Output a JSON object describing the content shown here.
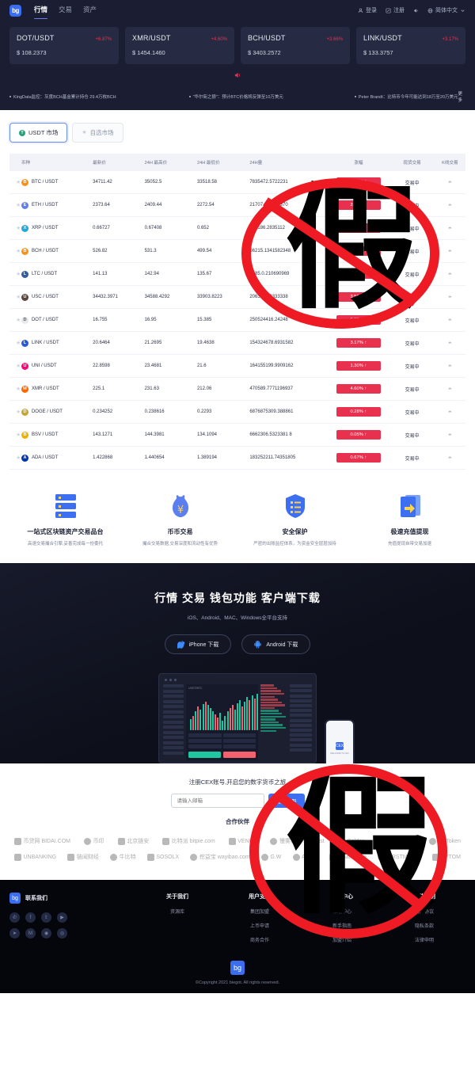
{
  "header": {
    "logo": "bg",
    "nav": [
      {
        "label": "行情",
        "active": true
      },
      {
        "label": "交易",
        "active": false
      },
      {
        "label": "资产",
        "active": false
      }
    ],
    "login": "登录",
    "register": "注册",
    "language": "简体中文"
  },
  "tickers": [
    {
      "pair": "DOT/USDT",
      "change": "+6.87%",
      "price": "$ 108.2373"
    },
    {
      "pair": "XMR/USDT",
      "change": "+4.60%",
      "price": "$ 1454.1460"
    },
    {
      "pair": "BCH/USDT",
      "change": "+3.66%",
      "price": "$ 3403.2572"
    },
    {
      "pair": "LINK/USDT",
      "change": "+3.17%",
      "price": "$ 133.3757"
    }
  ],
  "news": {
    "items": [
      "KingData监控：灰度BCH基金累计持仓 29.4万枚BCH",
      "“华尔街之狼”：预计BTC价格将反弹至10万美元",
      "Peter Brandt：比特币今年可能达到18万至20万美元"
    ],
    "more": "更多"
  },
  "market": {
    "tabs": [
      {
        "label": "USDT 市场",
        "icon": "usdt-icon",
        "active": true
      },
      {
        "label": "自选市场",
        "icon": "star-icon",
        "active": false
      }
    ],
    "columns": [
      "币种",
      "最新价",
      "24H 最高价",
      "24H 最低价",
      "24H量",
      "涨幅",
      "现货交易",
      "K线交易"
    ],
    "rows": [
      {
        "coin": "BTC / USDT",
        "symbol": "B",
        "color": "#f7931a",
        "last": "34711.42",
        "high": "35052.5",
        "low": "33518.58",
        "vol": "7835472.5722231",
        "change": "3.09% ↑",
        "trade": "交易中"
      },
      {
        "coin": "ETH / USDT",
        "symbol": "E",
        "color": "#627eea",
        "last": "2373.64",
        "high": "2409.44",
        "low": "2272.54",
        "vol": "21707.002742370",
        "change": "2.24% ↑",
        "trade": "交易中"
      },
      {
        "coin": "XRP / USDT",
        "symbol": "X",
        "color": "#23a7df",
        "last": "0.66727",
        "high": "0.67408",
        "low": "0.652",
        "vol": "137186.2835112",
        "change": "1.71% ↑",
        "trade": "交易中"
      },
      {
        "coin": "BCH / USDT",
        "symbol": "B",
        "color": "#f7931a",
        "last": "526.82",
        "high": "531.3",
        "low": "499.54",
        "vol": "66215.1341582348",
        "change": "3.66% ↑",
        "trade": "交易中"
      },
      {
        "coin": "LTC / USDT",
        "symbol": "L",
        "color": "#345d9d",
        "last": "141.13",
        "high": "142.94",
        "low": "135.67",
        "vol": "5285.0.210690969",
        "change": "2.11% ↑",
        "trade": "交易中"
      },
      {
        "coin": "USC / USDT",
        "symbol": "U",
        "color": "#59463c",
        "last": "34432.3971",
        "high": "34588.4292",
        "low": "33903.8223",
        "vol": "206349.28333338",
        "change": "3.56% ↑",
        "trade": "交易中"
      },
      {
        "coin": "DOT / USDT",
        "symbol": "D",
        "color": "#e6e8ee",
        "last": "16.755",
        "high": "16.95",
        "low": "15.385",
        "vol": "250524416.24248",
        "change": "6.87% ↑",
        "trade": "交易中"
      },
      {
        "coin": "LINK / USDT",
        "symbol": "L",
        "color": "#2a5ada",
        "last": "20.6464",
        "high": "21.2695",
        "low": "19.4638",
        "vol": "154324678.6931582",
        "change": "3.17% ↑",
        "trade": "交易中"
      },
      {
        "coin": "UNI / USDT",
        "symbol": "U",
        "color": "#ff007a",
        "last": "22.8598",
        "high": "23.4681",
        "low": "21.6",
        "vol": "164155199.9909162",
        "change": "1.30% ↑",
        "trade": "交易中"
      },
      {
        "coin": "XMR / USDT",
        "symbol": "M",
        "color": "#ff6600",
        "last": "225.1",
        "high": "231.63",
        "low": "212.06",
        "vol": "470589.7771196937",
        "change": "4.60% ↑",
        "trade": "交易中"
      },
      {
        "coin": "DOGE / USDT",
        "symbol": "D",
        "color": "#c3a634",
        "last": "0.234252",
        "high": "0.238616",
        "low": "0.2293",
        "vol": "6876875309.388861",
        "change": "0.28% ↑",
        "trade": "交易中"
      },
      {
        "coin": "BSV / USDT",
        "symbol": "B",
        "color": "#eab300",
        "last": "143.1271",
        "high": "144.3981",
        "low": "134.1094",
        "vol": "6662306.5323381 8",
        "change": "0.05% ↑",
        "trade": "交易中"
      },
      {
        "coin": "ADA / USDT",
        "symbol": "A",
        "color": "#0033ad",
        "last": "1.422868",
        "high": "1.440654",
        "low": "1.389194",
        "vol": "183252211.74351805",
        "change": "0.67% ↑",
        "trade": "交易中"
      }
    ],
    "kline_icon": "kline-icon",
    "star_icon": "star-icon"
  },
  "features": [
    {
      "icon": "server-icon",
      "title": "一站式区块链资产交易品台",
      "desc": "高速交易撮合引擎,妥善完成每一份委托"
    },
    {
      "icon": "money-bag-icon",
      "title": "币币交易",
      "desc": "撮合交易数据,交易深度和流动性有优势"
    },
    {
      "icon": "shield-list-icon",
      "title": "安全保护",
      "desc": "严密的出账监控体系，为资金安全层层加持"
    },
    {
      "icon": "fast-transfer-icon",
      "title": "极速充值提现",
      "desc": "充值提现自带交易加速"
    }
  ],
  "download": {
    "title": "行情 交易 钱包功能 客户端下载",
    "subtitle": "iOS、Android、MAC、Windows全平台支持",
    "buttons": [
      {
        "label": "iPhone 下载",
        "icon": "apple-icon"
      },
      {
        "label": "Android 下载",
        "icon": "android-icon"
      }
    ],
    "mock_pair": "USDT/BTC",
    "phone_logo": "CEX",
    "phone_caption": "WELCOME TO CEX"
  },
  "signup": {
    "title": "注册CEX账号,开启您的数字货币之旅",
    "placeholder": "请输入邮箱",
    "value": "",
    "button": "立即注册",
    "partners_title": "合作伙伴"
  },
  "partners": {
    "row1": [
      "币贷网 BIDAI.COM",
      "币印",
      "北京链安",
      "比特派 bitpie.com",
      "VENUS",
      "慢雾科技 slowmist",
      "Golden",
      "ChainNews",
      "MyToken"
    ],
    "row2": [
      "UNBANKING",
      "链闻财经",
      "牛比特",
      "SOSOLX",
      "挖益宝 wayibao.com",
      "G.W",
      "AICoin",
      "ChainStore",
      "FIRSTMINER",
      "BYTOM"
    ]
  },
  "footer": {
    "brand_logo": "bg",
    "brand": "联系我们",
    "socials_row1": [
      "wechat-icon",
      "facebook-icon",
      "twitter-icon",
      "youtube-icon"
    ],
    "socials_row2": [
      "telegram-icon",
      "medium-icon",
      "instagram-icon",
      "weibo-icon"
    ],
    "columns": [
      {
        "title": "关于我们",
        "links": [
          "资源库"
        ]
      },
      {
        "title": "用户支持",
        "links": [
          "集团加盟",
          "上币申请",
          "商务合作"
        ]
      },
      {
        "title": "服务中心",
        "links": [
          "帮助中心",
          "新手指南",
          "加盟介绍"
        ]
      },
      {
        "title": "条款说明",
        "links": [
          "用户协议",
          "隐私条款",
          "法律申明"
        ]
      }
    ],
    "logo_bottom": "bg",
    "copyright": "©Copyright 2021 biegot. All rights reserved."
  },
  "watermarks": [
    {
      "char": "假",
      "note": "top-overlay"
    },
    {
      "char": "假",
      "note": "bottom-overlay"
    }
  ],
  "colors": {
    "accent": "#3d6ff2",
    "up": "#e8304f",
    "dark_bg": "#1b1e33",
    "watermark": "#ee1b24"
  }
}
